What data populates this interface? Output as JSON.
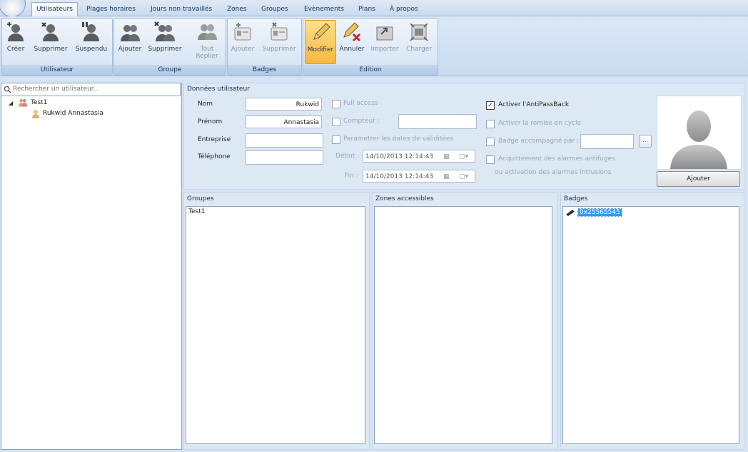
{
  "tabs": [
    {
      "label": "Utilisateurs",
      "active": true
    },
    {
      "label": "Plages horaires"
    },
    {
      "label": "Jours non travaillés"
    },
    {
      "label": "Zones"
    },
    {
      "label": "Groupes"
    },
    {
      "label": "Evènements"
    },
    {
      "label": "Plans"
    },
    {
      "label": "À propos"
    }
  ],
  "ribbon": {
    "utilisateur": {
      "label": "Utilisateur",
      "buttons": [
        "Créer",
        "Supprimer",
        "Suspendu"
      ]
    },
    "groupe": {
      "label": "Groupe",
      "buttons": [
        "Ajouter",
        "Supprimer",
        "Tout",
        "Replier"
      ]
    },
    "badges": {
      "label": "Badges",
      "buttons": [
        "Ajouter",
        "Supprimer"
      ]
    },
    "edition": {
      "label": "Edition",
      "buttons": [
        "Modifier",
        "Annuler",
        "Importer",
        "Charger"
      ]
    }
  },
  "search": {
    "placeholder": "Rechercher un utilisateur..."
  },
  "tree": {
    "group": "Test1",
    "user": "Rukwid Annastasia"
  },
  "user_data": {
    "title": "Données utilisateur",
    "nom_label": "Nom",
    "nom_value": "Rukwid",
    "prenom_label": "Prénom",
    "prenom_value": "Annastasia",
    "entreprise_label": "Entreprise",
    "entreprise_value": "",
    "telephone_label": "Téléphone",
    "telephone_value": "",
    "full_access": "Full access",
    "compteur": "Compteur :",
    "dates_validite": "Parametrer les dates de validitées",
    "debut_label": "Début :",
    "debut_value": "14/10/2013 12:14:43",
    "fin_label": "Fin :",
    "fin_value": "14/10/2013 12:14:43",
    "antipassback": "Activer l'AntiPassBack",
    "remise_cycle": "Activer la remise en cycle",
    "badge_accompagne": "Badge accompagné par :",
    "badge_more": "...",
    "acquittement_1": "Acquittement des alarmes antifuges",
    "acquittement_2": "ou activation des alarmes intrusions",
    "ajouter_photo": "Ajouter"
  },
  "groupes": {
    "title": "Groupes",
    "items": [
      "Test1"
    ]
  },
  "zones": {
    "title": "Zones accessibles",
    "items": []
  },
  "badges": {
    "title": "Badges",
    "items": [
      "0x25565545"
    ]
  },
  "colors": {
    "accent": "#f6b840",
    "selection": "#3399ff",
    "ribbon": "#c9dbf0"
  }
}
